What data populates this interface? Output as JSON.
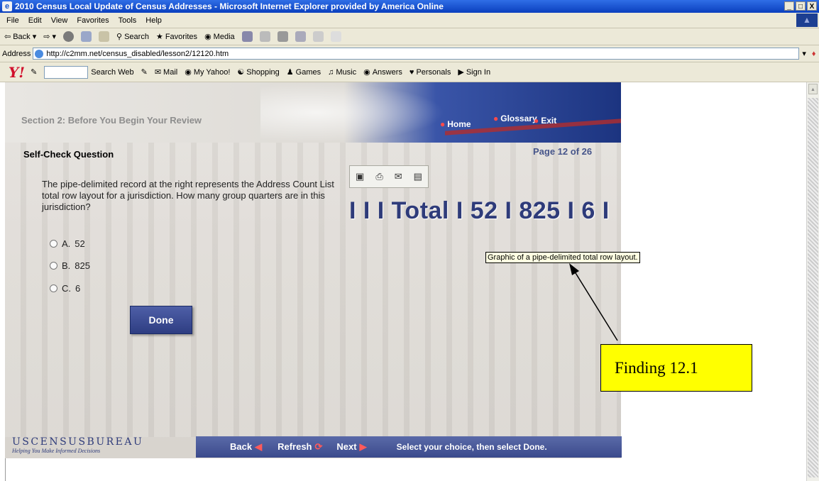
{
  "window": {
    "title": "2010 Census Local Update of Census Addresses - Microsoft Internet Explorer provided by America Online",
    "min": "_",
    "max": "□",
    "close": "X"
  },
  "menu": {
    "items": [
      "File",
      "Edit",
      "View",
      "Favorites",
      "Tools",
      "Help"
    ]
  },
  "toolbar": {
    "back": "Back",
    "search": "Search",
    "favorites": "Favorites",
    "media": "Media"
  },
  "address": {
    "label": "Address",
    "url": "http://c2mm.net/census_disabled/lesson2/12120.htm"
  },
  "yahoo": {
    "logo": "Y!",
    "search_web": "Search Web",
    "mail": "Mail",
    "my_yahoo": "My Yahoo!",
    "shopping": "Shopping",
    "games": "Games",
    "music": "Music",
    "answers": "Answers",
    "personals": "Personals",
    "sign_in": "Sign In"
  },
  "lesson": {
    "section_title": "Section 2: Before You Begin Your Review",
    "nav": {
      "home": "Home",
      "glossary": "Glossary",
      "exit": "Exit"
    },
    "heading": "Self-Check Question",
    "page": "Page 12 of 26",
    "question": "The pipe-delimited record at the right represents the Address Count List total row layout for a jurisdiction. How many group quarters are in this jurisdiction?",
    "options": [
      {
        "letter": "A.",
        "value": "52"
      },
      {
        "letter": "B.",
        "value": "825"
      },
      {
        "letter": "C.",
        "value": "6"
      }
    ],
    "done": "Done",
    "record": "I I I Total I 52 I 825 I 6 I",
    "tooltip": "Graphic of a pipe-delimited total row layout.",
    "callout": "Finding 12.1",
    "bottom": {
      "back": "Back",
      "refresh": "Refresh",
      "next": "Next",
      "hint": "Select your choice, then select Done."
    },
    "logo": {
      "name": "USCENSUSBUREAU",
      "tagline": "Helping You Make Informed Decisions"
    }
  }
}
